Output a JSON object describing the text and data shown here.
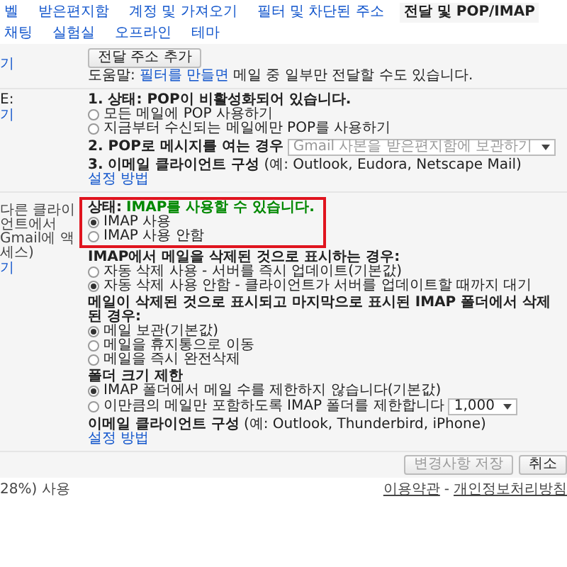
{
  "tabs": [
    {
      "label": "벨",
      "selected": false
    },
    {
      "label": "받은편지함",
      "selected": false
    },
    {
      "label": "계정 및 가져오기",
      "selected": false
    },
    {
      "label": "필터 및 차단된 주소",
      "selected": false
    },
    {
      "label": "전달 및 POP/IMAP",
      "selected": true
    },
    {
      "label": "채팅",
      "selected": false
    },
    {
      "label": "실험실",
      "selected": false
    },
    {
      "label": "오프라인",
      "selected": false
    },
    {
      "label": "테마",
      "selected": false
    }
  ],
  "forwarding": {
    "left_link": "기",
    "button": "전달 주소 추가",
    "help_prefix": "도움말:",
    "help_link": "필터를 만들면",
    "help_suffix": "메일 중 일부만 전달할 수도 있습니다."
  },
  "pop": {
    "left_label": "E:",
    "left_link": "기",
    "status": "1. 상태: POP이 비활성화되어 있습니다.",
    "options": [
      {
        "label": "모든 메일에 POP 사용하기",
        "selected": false
      },
      {
        "label": "지금부터 수신되는 메일에만 POP를 사용하기",
        "selected": false
      }
    ],
    "open_label": "2. POP로 메시지를 여는 경우",
    "open_select": {
      "value": "Gmail 사본을 받은편지함에 보관하기",
      "disabled": true
    },
    "client_label": "3. 이메일 클라이언트 구성",
    "client_hint": "(예: Outlook, Eudora, Netscape Mail)",
    "client_link": "설정 방법"
  },
  "imap": {
    "left_note": "다른 클라이언트에서 Gmail에 액세스)",
    "left_link": "기",
    "status_label": "상태:",
    "status_value": "IMAP를 사용할 수 있습니다.",
    "highlighted": true,
    "options": [
      {
        "label": "IMAP 사용",
        "selected": true
      },
      {
        "label": "IMAP 사용 안함",
        "selected": false
      }
    ],
    "groups": [
      {
        "title": "IMAP에서 메일을 삭제된 것으로 표시하는 경우:",
        "options": [
          {
            "label": "자동 삭제 사용 - 서버를 즉시 업데이트(기본값)",
            "selected": false
          },
          {
            "label": "자동 삭제 사용 안함 - 클라이언트가 서버를 업데이트할 때까지 대기",
            "selected": true
          }
        ]
      },
      {
        "title": "메일이 삭제된 것으로 표시되고 마지막으로 표시된 IMAP 폴더에서 삭제된 경우:",
        "options": [
          {
            "label": "메일 보관(기본값)",
            "selected": true
          },
          {
            "label": "메일을 휴지통으로 이동",
            "selected": false
          },
          {
            "label": "메일을 즉시 완전삭제",
            "selected": false
          }
        ]
      },
      {
        "title": "폴더 크기 제한",
        "options": [
          {
            "label": "IMAP 폴더에서 메일 수를 제한하지 않습니다(기본값)",
            "selected": true
          },
          {
            "label": "이만큼의 메일만 포함하도록 IMAP 폴더를 제한합니다",
            "selected": false,
            "select": "1,000"
          }
        ]
      }
    ],
    "client_label": "이메일 클라이언트 구성",
    "client_hint": "(예: Outlook, Thunderbird, iPhone)",
    "client_link": "설정 방법"
  },
  "actions": [
    {
      "label": "변경사항 저장",
      "disabled": true
    },
    {
      "label": "취소",
      "disabled": false
    }
  ],
  "footer": {
    "usage": "28%) 사용",
    "links": [
      "이용약관",
      "개인정보처리방침"
    ],
    "separator": "-"
  }
}
